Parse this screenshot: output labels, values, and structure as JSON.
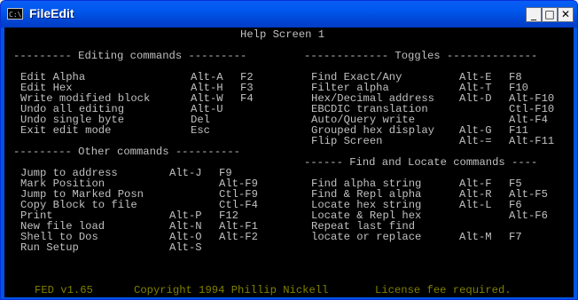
{
  "window": {
    "title": "FileEdit",
    "icon": "console-icon"
  },
  "screen": {
    "header": "Help Screen 1",
    "left": {
      "editing_title": "--------- Editing commands ---------",
      "editing": [
        [
          "Edit Alpha",
          "Alt-A",
          "F2"
        ],
        [
          "Edit Hex",
          "Alt-H",
          "F3"
        ],
        [
          "Write modified block",
          "Alt-W",
          "F4"
        ],
        [
          "Undo all editing",
          "Alt-U",
          ""
        ],
        [
          "Undo single byte",
          "Del",
          ""
        ],
        [
          "Exit edit mode",
          "Esc",
          ""
        ]
      ],
      "other_title": "--------- Other commands ----------",
      "other": [
        [
          "Jump to address",
          "Alt-J",
          "F9"
        ],
        [
          "Mark Position",
          "",
          "Alt-F9"
        ],
        [
          "Jump to Marked Posn",
          "",
          "Ctl-F9"
        ],
        [
          "Copy Block to file",
          "",
          "Ctl-F4"
        ],
        [
          "Print",
          "Alt-P",
          "F12"
        ],
        [
          "New file load",
          "Alt-N",
          "Alt-F1"
        ],
        [
          "Shell to Dos",
          "Alt-O",
          "Alt-F2"
        ],
        [
          "Run Setup",
          "Alt-S",
          ""
        ]
      ]
    },
    "right": {
      "toggles_title": "------------- Toggles --------------",
      "toggles": [
        [
          "Find Exact/Any",
          "Alt-E",
          "F8"
        ],
        [
          "Filter alpha",
          "Alt-T",
          "F10"
        ],
        [
          "Hex/Decimal address",
          "Alt-D",
          "Alt-F10"
        ],
        [
          "EBCDIC translation",
          "",
          "Ctl-F10"
        ],
        [
          "Auto/Query write",
          "",
          "Alt-F4"
        ],
        [
          "Grouped hex display",
          "Alt-G",
          "F11"
        ],
        [
          "Flip Screen",
          "Alt-=",
          "Alt-F11"
        ]
      ],
      "find_title": "------ Find and Locate commands ----",
      "find": [
        [
          "Find alpha string",
          "Alt-F",
          "F5"
        ],
        [
          "Find & Repl alpha",
          "Alt-R",
          "Alt-F5"
        ],
        [
          "Locate hex string",
          "Alt-L",
          "F6"
        ],
        [
          "Locate & Repl hex",
          "",
          "Alt-F6"
        ],
        [
          "Repeat last find",
          "",
          ""
        ],
        [
          "locate or replace",
          "Alt-M",
          "F7"
        ]
      ]
    },
    "status": {
      "version": "FED v1.65",
      "copyright": "Copyright 1994 Phillip Nickell",
      "license": "License fee required."
    }
  }
}
